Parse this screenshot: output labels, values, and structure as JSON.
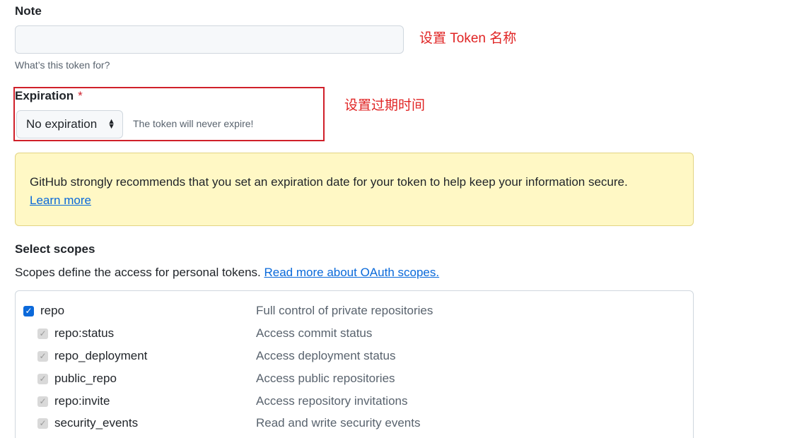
{
  "note": {
    "label": "Note",
    "value": "",
    "placeholder": "",
    "hint": "What’s this token for?",
    "annotation": "设置 Token 名称"
  },
  "expiration": {
    "label": "Expiration",
    "required_mark": "*",
    "selected": "No expiration",
    "message": "The token will never expire!",
    "annotation": "设置过期时间"
  },
  "flash": {
    "text": "GitHub strongly recommends that you set an expiration date for your token to help keep your information secure.",
    "link": "Learn more"
  },
  "scopes": {
    "label": "Select scopes",
    "description": "Scopes define the access for personal tokens.",
    "link": "Read more about OAuth scopes.",
    "items": [
      {
        "name": "repo",
        "desc": "Full control of private repositories",
        "checked": true,
        "child": false
      },
      {
        "name": "repo:status",
        "desc": "Access commit status",
        "checked": true,
        "child": true
      },
      {
        "name": "repo_deployment",
        "desc": "Access deployment status",
        "checked": true,
        "child": true
      },
      {
        "name": "public_repo",
        "desc": "Access public repositories",
        "checked": true,
        "child": true
      },
      {
        "name": "repo:invite",
        "desc": "Access repository invitations",
        "checked": true,
        "child": true
      },
      {
        "name": "security_events",
        "desc": "Read and write security events",
        "checked": true,
        "child": true
      }
    ]
  },
  "colors": {
    "annotation": "#e02424",
    "link": "#0969da",
    "checkbox": "#0b69da",
    "flash_bg": "#fff8c5"
  }
}
